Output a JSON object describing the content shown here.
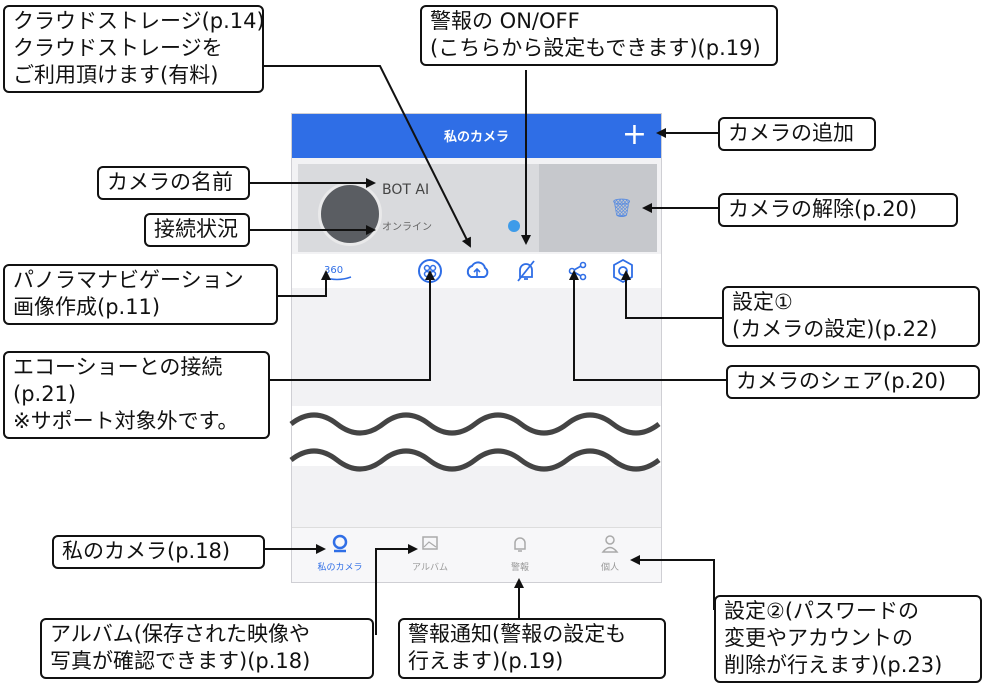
{
  "phone": {
    "header_title": "私のカメラ",
    "add_symbol": "+",
    "camera_name": "BOT AI",
    "camera_status": "オンライン",
    "icon_360_label": "360",
    "tabs": [
      {
        "label": "私のカメラ",
        "icon": "camera-pin-icon",
        "active": true
      },
      {
        "label": "アルバム",
        "icon": "image-icon",
        "active": false
      },
      {
        "label": "警報",
        "icon": "bell-icon",
        "active": false
      },
      {
        "label": "個人",
        "icon": "person-icon",
        "active": false
      }
    ],
    "accent_color": "#2f6ee6"
  },
  "callouts": {
    "cloud": [
      "クラウドストレージ(p.14)",
      "クラウドストレージを",
      "ご利用頂けます(有料)"
    ],
    "alarm_onoff": [
      "警報の ON/OFF",
      "(こちらから設定もできます)(p.19)"
    ],
    "add_camera": [
      "カメラの追加"
    ],
    "camera_name": [
      "カメラの名前"
    ],
    "connection_status": [
      "接続状況"
    ],
    "remove_camera": [
      "カメラの解除(p.20)"
    ],
    "panorama": [
      "パノラマナビゲーション",
      "画像作成(p.11)"
    ],
    "settings1": [
      "設定①",
      "(カメラの設定)(p.22)"
    ],
    "echo": [
      "エコーショーとの接続",
      "(p.21)",
      "※サポート対象外です。"
    ],
    "share": [
      "カメラのシェア(p.20)"
    ],
    "my_camera": [
      "私のカメラ(p.18)"
    ],
    "album": [
      "アルバム(保存された映像や",
      "写真が確認できます)(p.18)"
    ],
    "alarm_notice": [
      "警報通知(警報の設定も",
      "行えます)(p.19)"
    ],
    "settings2": [
      "設定②(パスワードの",
      "変更やアカウントの",
      "削除が行えます)(p.23)"
    ]
  }
}
